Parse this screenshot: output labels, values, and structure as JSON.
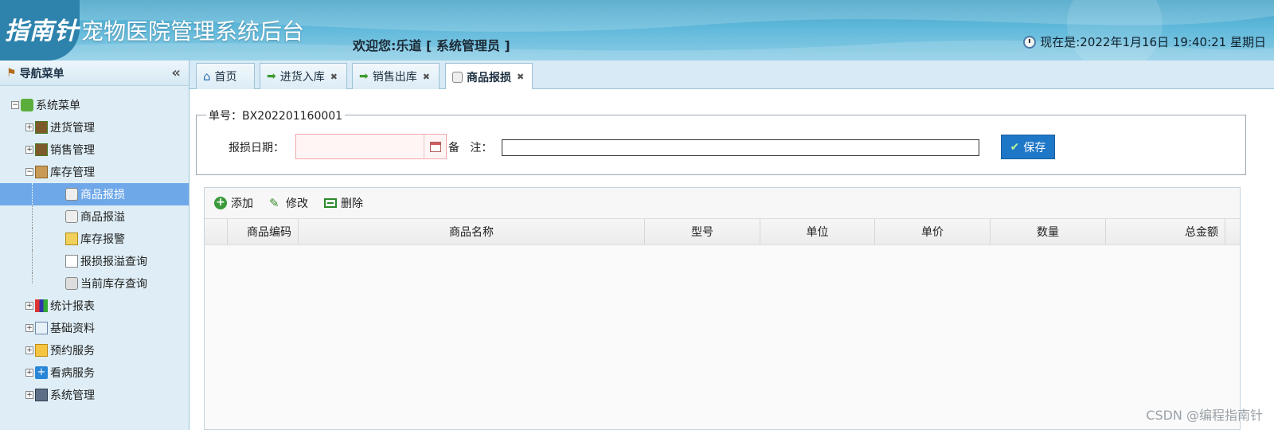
{
  "header": {
    "logo": "指南针",
    "title": "宠物医院管理系统后台",
    "welcome": "欢迎您:乐道 [ 系统管理员 ]",
    "clock": "现在是:2022年1月16日 19:40:21 星期日"
  },
  "sidebar": {
    "title": "导航菜单",
    "collapse": "«",
    "root": "系统菜单",
    "items": [
      {
        "label": "进货管理",
        "icon": "purchase-icon",
        "expand": "+"
      },
      {
        "label": "销售管理",
        "icon": "sale-icon",
        "expand": "+"
      },
      {
        "label": "库存管理",
        "icon": "folder-open-icon",
        "expand": "−"
      },
      {
        "label": "商品报损",
        "icon": "damage-icon"
      },
      {
        "label": "商品报溢",
        "icon": "overflow-icon"
      },
      {
        "label": "库存报警",
        "icon": "warning-icon"
      },
      {
        "label": "报损报溢查询",
        "icon": "query-icon"
      },
      {
        "label": "当前库存查询",
        "icon": "stock-query-icon"
      },
      {
        "label": "统计报表",
        "icon": "chart-icon",
        "expand": "+"
      },
      {
        "label": "基础资料",
        "icon": "document-icon",
        "expand": "+"
      },
      {
        "label": "预约服务",
        "icon": "appointment-icon",
        "expand": "+"
      },
      {
        "label": "看病服务",
        "icon": "medical-icon",
        "expand": "+"
      },
      {
        "label": "系统管理",
        "icon": "computer-icon",
        "expand": "+"
      }
    ]
  },
  "tabs": [
    {
      "label": "首页",
      "icon": "home-icon"
    },
    {
      "label": "进货入库",
      "icon": "arrow-in-icon",
      "close": "✖"
    },
    {
      "label": "销售出库",
      "icon": "arrow-out-icon",
      "close": "✖"
    },
    {
      "label": "商品报损",
      "icon": "damage-icon",
      "close": "✖"
    }
  ],
  "form": {
    "order_no": "单号：BX202201160001",
    "date_label": "报损日期：",
    "date_value": "",
    "remark_label": "备   注：",
    "remark_value": "",
    "save_label": "保存"
  },
  "toolbar": {
    "add_label": "添加",
    "edit_label": "修改",
    "delete_label": "删除"
  },
  "table": {
    "columns": [
      "商品编码",
      "商品名称",
      "型号",
      "单位",
      "单价",
      "数量",
      "总金额"
    ],
    "rows": []
  },
  "watermark": "CSDN @编程指南针",
  "colors": {
    "header_bg": "#5fb8da",
    "sidebar_bg": "#dfeef6",
    "selected": "#6fa8e8",
    "save_button": "#1f77c8"
  }
}
